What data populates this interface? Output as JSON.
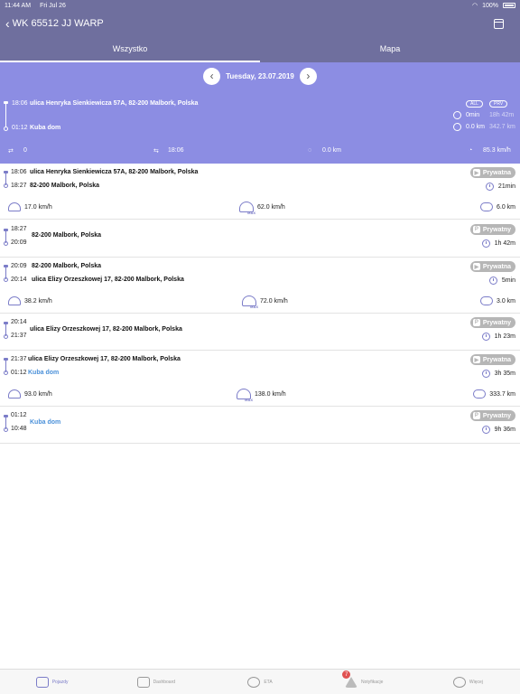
{
  "status_bar": {
    "time": "11:44 AM",
    "date": "Fri Jul 26",
    "battery": "100%"
  },
  "header": {
    "title": "WK 65512 JJ WARP"
  },
  "tabs": [
    {
      "label": "Wszystko"
    },
    {
      "label": "Mapa"
    }
  ],
  "date_nav": {
    "date": "Tuesday, 23.07.2019",
    "prev": "‹",
    "next": "›"
  },
  "summary": {
    "start_time": "18:06",
    "start_address": "ulica Henryka Sienkiewicza 57A, 82-200 Malbork, Polska",
    "end_time": "01:12",
    "end_address": "Kuba dom",
    "tag_all": "ALL",
    "tag_prv": "PRV",
    "idle_time": "0min",
    "total_time": "18h 42m",
    "idle_distance": "0.0 km",
    "total_distance": "342.7 km",
    "stats": {
      "count": "0",
      "time": "18:06",
      "distance": "0.0 km",
      "max_speed": "85.3 km/h"
    }
  },
  "trips": [
    {
      "type": "drive",
      "start_time": "18:06",
      "start_address": "ulica Henryka Sienkiewicza 57A, 82-200 Malbork, Polska",
      "end_time": "18:27",
      "end_address": "82-200 Malbork, Polska",
      "badge": "Prywatna",
      "duration": "21min",
      "avg_speed": "17.0 km/h",
      "max_speed": "62.0 km/h",
      "distance": "6.0 km"
    },
    {
      "type": "stop",
      "start_time": "18:27",
      "address": "82-200 Malbork, Polska",
      "end_time": "20:09",
      "badge": "Prywatny",
      "duration": "1h 42m"
    },
    {
      "type": "drive",
      "start_time": "20:09",
      "start_address": "82-200 Malbork, Polska",
      "end_time": "20:14",
      "end_address": "ulica Elizy Orzeszkowej 17, 82-200 Malbork, Polska",
      "badge": "Prywatna",
      "duration": "5min",
      "avg_speed": "38.2 km/h",
      "max_speed": "72.0 km/h",
      "distance": "3.0 km"
    },
    {
      "type": "stop",
      "start_time": "20:14",
      "address": "ulica Elizy Orzeszkowej 17, 82-200 Malbork, Polska",
      "end_time": "21:37",
      "badge": "Prywatny",
      "duration": "1h 23m"
    },
    {
      "type": "drive",
      "start_time": "21:37",
      "start_address": "ulica Elizy Orzeszkowej 17, 82-200 Malbork, Polska",
      "end_time": "01:12",
      "end_address": "Kuba dom",
      "badge": "Prywatna",
      "duration": "3h 35m",
      "avg_speed": "93.0 km/h",
      "max_speed": "138.0 km/h",
      "distance": "333.7 km"
    },
    {
      "type": "stop",
      "start_time": "01:12",
      "address": "Kuba dom",
      "end_time": "10:48",
      "badge": "Prywatny",
      "duration": "9h 36m"
    }
  ],
  "max_label": "MAX",
  "bottom_nav": [
    {
      "label": "Pojazdy"
    },
    {
      "label": "Dashboard"
    },
    {
      "label": "ETA"
    },
    {
      "label": "Notyfikacje",
      "badge": "7"
    },
    {
      "label": "Więcej"
    }
  ],
  "colors": {
    "header": "#6f6f9e",
    "summary": "#8c8de3",
    "accent": "#7b7cc8",
    "link": "#4a90d9",
    "badge": "#b6b6b6"
  }
}
